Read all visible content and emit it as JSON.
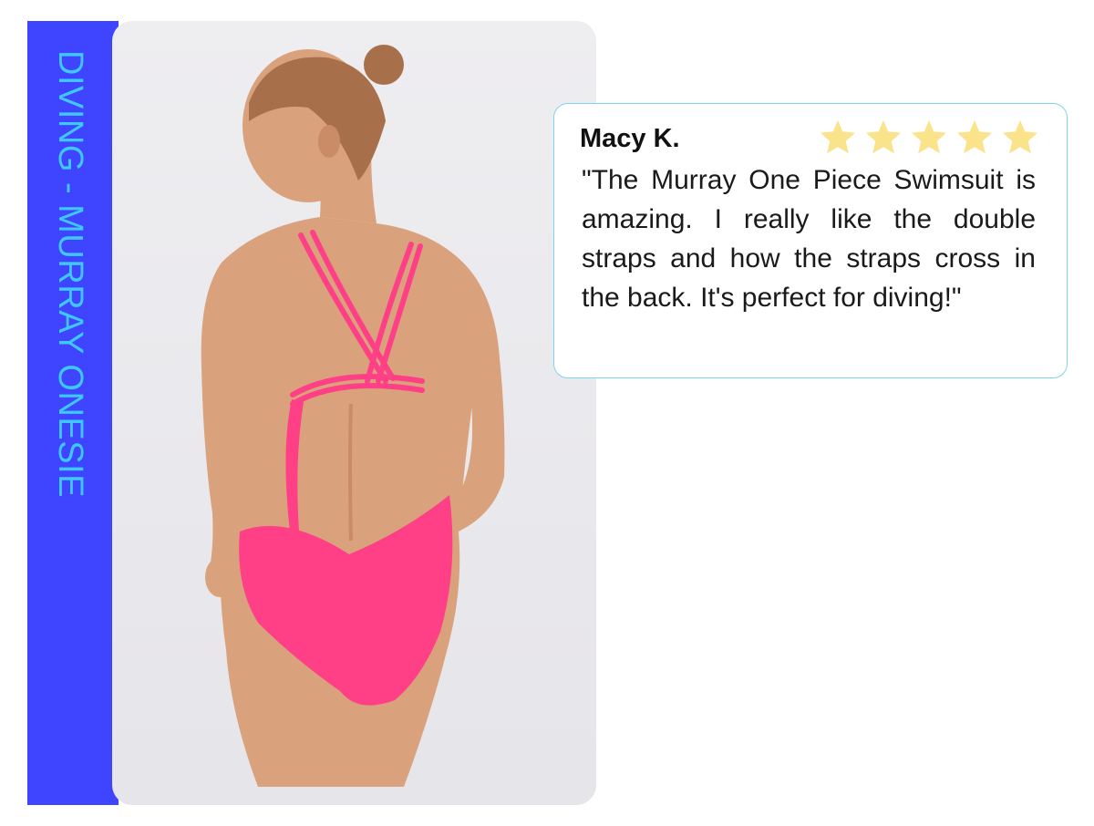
{
  "sidebar": {
    "label": "DIVING - MURRAY ONESIE"
  },
  "review": {
    "name": "Macy K.",
    "rating": 5,
    "max_rating": 5,
    "text": "\"The Murray One Piece Swimsuit is amazing. I really like the double straps and how the straps cross in the back. It's perfect for diving!\""
  },
  "colors": {
    "band": "#3f45ff",
    "band_text": "#3ec8ff",
    "card_border": "#7fd3ee",
    "star": "#fbe38b",
    "swimsuit": "#ff3f86"
  }
}
